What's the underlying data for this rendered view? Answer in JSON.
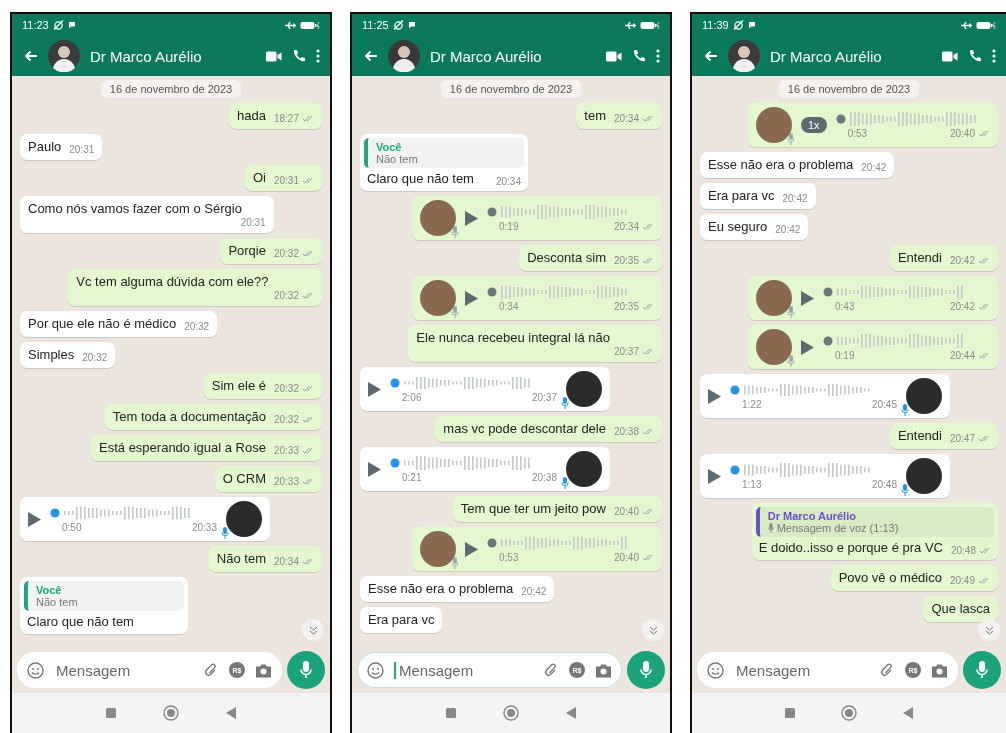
{
  "phones": [
    {
      "status_time": "11:23",
      "contact_name": "Dr Marco Aurélio",
      "input_placeholder": "Mensagem",
      "payment_badge": "R$",
      "focused": false,
      "messages": [
        {
          "kind": "date",
          "text": "16 de novembro de 2023"
        },
        {
          "kind": "text",
          "outgoing": true,
          "text": "hada",
          "time": "18:27"
        },
        {
          "kind": "text",
          "outgoing": false,
          "text": "Paulo",
          "time": "20:31"
        },
        {
          "kind": "text",
          "outgoing": true,
          "text": "Oi",
          "time": "20:31"
        },
        {
          "kind": "text",
          "outgoing": false,
          "text": "Como nós vamos fazer com o Sérgio",
          "time": "20:31"
        },
        {
          "kind": "text",
          "outgoing": true,
          "text": "Porqie",
          "time": "20:32"
        },
        {
          "kind": "text",
          "outgoing": true,
          "text": "Vc tem alguma dúvida com ele??",
          "time": "20:32"
        },
        {
          "kind": "text",
          "outgoing": false,
          "text": "Por que ele não é médico",
          "time": "20:32"
        },
        {
          "kind": "text",
          "outgoing": false,
          "text": "Simples",
          "time": "20:32"
        },
        {
          "kind": "text",
          "outgoing": true,
          "text": "Sim ele é",
          "time": "20:32"
        },
        {
          "kind": "text",
          "outgoing": true,
          "text": "Tem toda a documentação",
          "time": "20:32"
        },
        {
          "kind": "text",
          "outgoing": true,
          "text": "Está esperando igual a Rose",
          "time": "20:33"
        },
        {
          "kind": "text",
          "outgoing": true,
          "text": "O CRM",
          "time": "20:33"
        },
        {
          "kind": "voice",
          "outgoing": false,
          "duration": "0:50",
          "time": "20:33"
        },
        {
          "kind": "text",
          "outgoing": true,
          "text": "Não tem",
          "time": "20:34"
        },
        {
          "kind": "reply",
          "outgoing": false,
          "author": "Você",
          "color": "#1fa67a",
          "quote_voice": false,
          "quoted": "Não tem",
          "text": "Claro que não tem"
        }
      ]
    },
    {
      "status_time": "11:25",
      "contact_name": "Dr Marco Aurélio",
      "input_placeholder": "Mensagem",
      "payment_badge": "R$",
      "focused": true,
      "messages": [
        {
          "kind": "date",
          "text": "16 de novembro de 2023"
        },
        {
          "kind": "text",
          "outgoing": true,
          "text": "tem",
          "time": "20:34"
        },
        {
          "kind": "reply",
          "outgoing": false,
          "author": "Você",
          "color": "#1fa67a",
          "quote_voice": false,
          "quoted": "Não tem",
          "text": "Claro que não tem",
          "time": "20:34"
        },
        {
          "kind": "voice",
          "outgoing": true,
          "duration": "0:19",
          "time": "20:34"
        },
        {
          "kind": "text",
          "outgoing": true,
          "text": "Desconta sim",
          "time": "20:35"
        },
        {
          "kind": "voice",
          "outgoing": true,
          "duration": "0:34",
          "time": "20:35"
        },
        {
          "kind": "text",
          "outgoing": true,
          "text": "Ele nunca recebeu integral lá não",
          "time": "20:37"
        },
        {
          "kind": "voice",
          "outgoing": false,
          "duration": "2:06",
          "time": "20:37"
        },
        {
          "kind": "text",
          "outgoing": true,
          "text": "mas vc pode descontar dele",
          "time": "20:38"
        },
        {
          "kind": "voice",
          "outgoing": false,
          "duration": "0:21",
          "time": "20:38"
        },
        {
          "kind": "text",
          "outgoing": true,
          "text": "Tem que ter um jeito pow",
          "time": "20:40"
        },
        {
          "kind": "voice",
          "outgoing": true,
          "duration": "0:53",
          "time": "20:40"
        },
        {
          "kind": "text",
          "outgoing": false,
          "text": "Esse não era o problema",
          "time": "20:42"
        },
        {
          "kind": "text",
          "outgoing": false,
          "text": "Era para vc"
        }
      ]
    },
    {
      "status_time": "11:39",
      "contact_name": "Dr Marco Aurélio",
      "input_placeholder": "Mensagem",
      "payment_badge": "R$",
      "focused": false,
      "messages": [
        {
          "kind": "date",
          "text": "16 de novembro de 2023"
        },
        {
          "kind": "voice",
          "outgoing": true,
          "speed": "1x",
          "duration": "0:53",
          "time": "20:40"
        },
        {
          "kind": "text",
          "outgoing": false,
          "text": "Esse não era o problema",
          "time": "20:42"
        },
        {
          "kind": "text",
          "outgoing": false,
          "text": "Era para vc",
          "time": "20:42"
        },
        {
          "kind": "text",
          "outgoing": false,
          "text": "Eu seguro",
          "time": "20:42"
        },
        {
          "kind": "text",
          "outgoing": true,
          "text": "Entendi",
          "time": "20:42"
        },
        {
          "kind": "voice",
          "outgoing": true,
          "duration": "0:43",
          "time": "20:42"
        },
        {
          "kind": "voice",
          "outgoing": true,
          "duration": "0:19",
          "time": "20:44"
        },
        {
          "kind": "voice",
          "outgoing": false,
          "duration": "1:22",
          "time": "20:45"
        },
        {
          "kind": "text",
          "outgoing": true,
          "text": "Entendi",
          "time": "20:47"
        },
        {
          "kind": "voice",
          "outgoing": false,
          "duration": "1:13",
          "time": "20:48"
        },
        {
          "kind": "reply",
          "outgoing": true,
          "author": "Dr Marco Aurélio",
          "color": "#6b4fcf",
          "quote_voice": true,
          "quoted": "Mensagem de voz (1:13)",
          "text": "E doido..isso e porque é pra VC",
          "time": "20:48"
        },
        {
          "kind": "text",
          "outgoing": true,
          "text": "Povo vê o médico",
          "time": "20:49"
        },
        {
          "kind": "text",
          "outgoing": true,
          "text": "Que lasca"
        }
      ]
    }
  ]
}
